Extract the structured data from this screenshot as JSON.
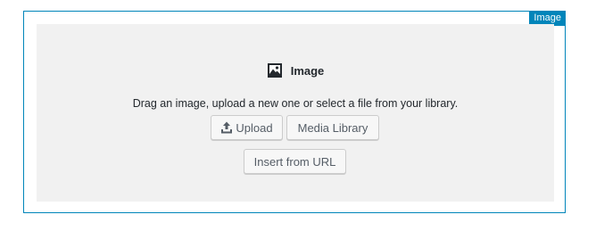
{
  "block": {
    "badge": "Image",
    "label": "Image",
    "icon": "image-icon",
    "instructions": "Drag an image, upload a new one or select a file from your library."
  },
  "buttons": {
    "upload": {
      "label": "Upload",
      "icon": "upload-icon"
    },
    "media_library": {
      "label": "Media Library"
    },
    "insert_url": {
      "label": "Insert from URL"
    }
  },
  "colors": {
    "accent": "#0085ba",
    "placeholder_bg": "#f1f1f1"
  }
}
